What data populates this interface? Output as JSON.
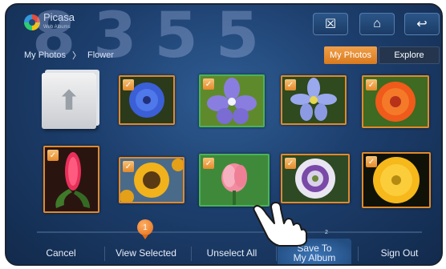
{
  "watermark": "8355",
  "app": {
    "logo_name": "Picasa",
    "logo_sub": "Web Albums"
  },
  "header": {
    "icons": [
      "gallery-settings-icon",
      "home-icon",
      "return-icon"
    ],
    "glyphs": {
      "settings": "☒",
      "home": "⌂",
      "back": "↩"
    }
  },
  "breadcrumb": {
    "root": "My Photos",
    "separator": "〉",
    "current": "Flower"
  },
  "tabs": {
    "active": "My Photos",
    "other": "Explore"
  },
  "grid": {
    "up_glyph": "⬆",
    "check_glyph": "✓",
    "photos": [
      {
        "name": "blue-cornflower",
        "selected": true
      },
      {
        "name": "purple-periwinkle",
        "selected": true
      },
      {
        "name": "blue-anemone",
        "selected": true
      },
      {
        "name": "orange-zinnia",
        "selected": true
      },
      {
        "name": "red-ginger",
        "selected": true
      },
      {
        "name": "sunflower",
        "selected": true
      },
      {
        "name": "pink-tulip",
        "selected": true
      },
      {
        "name": "passion-flower",
        "selected": true
      },
      {
        "name": "yellow-poppy",
        "selected": true
      }
    ]
  },
  "pager": {
    "current": "1",
    "next": "2"
  },
  "bottom_bar": {
    "cancel": "Cancel",
    "view_selected": "View Selected",
    "unselect_all": "Unselect All",
    "save_line1": "Save To",
    "save_line2": "My Album",
    "sign_out": "Sign Out"
  },
  "colors": {
    "accent": "#e08a2c",
    "selected_border": "#49b35a",
    "background": "#1d3f6e"
  }
}
